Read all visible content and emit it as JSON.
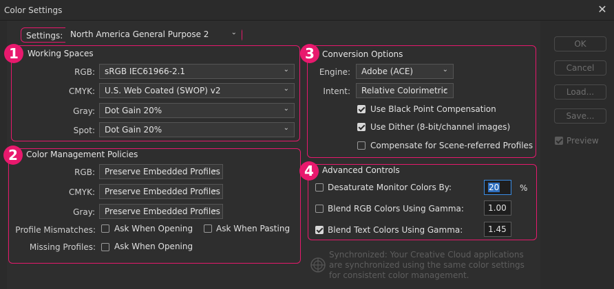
{
  "window": {
    "title": "Color Settings",
    "close_glyph": "✕"
  },
  "settings": {
    "label": "Settings:",
    "value": "North America General Purpose 2"
  },
  "working_spaces": {
    "title": "Working Spaces",
    "badge": "1",
    "rows": [
      {
        "label": "RGB:",
        "value": "sRGB IEC61966-2.1"
      },
      {
        "label": "CMYK:",
        "value": "U.S. Web Coated (SWOP) v2"
      },
      {
        "label": "Gray:",
        "value": "Dot Gain 20%"
      },
      {
        "label": "Spot:",
        "value": "Dot Gain 20%"
      }
    ]
  },
  "policies": {
    "title": "Color Management Policies",
    "badge": "2",
    "rows": [
      {
        "label": "RGB:",
        "value": "Preserve Embedded Profiles"
      },
      {
        "label": "CMYK:",
        "value": "Preserve Embedded Profiles"
      },
      {
        "label": "Gray:",
        "value": "Preserve Embedded Profiles"
      }
    ],
    "mismatch_label": "Profile Mismatches:",
    "mismatch_open": {
      "label": "Ask When Opening",
      "checked": false
    },
    "mismatch_paste": {
      "label": "Ask When Pasting",
      "checked": false
    },
    "missing_label": "Missing Profiles:",
    "missing_open": {
      "label": "Ask When Opening",
      "checked": false
    }
  },
  "conversion": {
    "title": "Conversion Options",
    "badge": "3",
    "engine_label": "Engine:",
    "engine_value": "Adobe (ACE)",
    "intent_label": "Intent:",
    "intent_value": "Relative Colorimetric",
    "black_point": {
      "label": "Use Black Point Compensation",
      "checked": true
    },
    "dither": {
      "label": "Use Dither (8-bit/channel images)",
      "checked": true
    },
    "scene": {
      "label": "Compensate for Scene-referred Profiles",
      "checked": false
    }
  },
  "advanced": {
    "title": "Advanced Controls",
    "badge": "4",
    "desaturate": {
      "label": "Desaturate Monitor Colors By:",
      "value": "20",
      "unit": "%",
      "checked": false
    },
    "blend_rgb": {
      "label": "Blend RGB Colors Using Gamma:",
      "value": "1.00",
      "checked": false
    },
    "blend_text": {
      "label": "Blend Text Colors Using Gamma:",
      "value": "1.45",
      "checked": true
    }
  },
  "buttons": {
    "ok": "OK",
    "cancel": "Cancel",
    "load": "Load...",
    "save": "Save...",
    "preview": "Preview"
  },
  "sync_message": "Synchronized: Your Creative Cloud applications are synchronized using the same color settings for consistent color management.",
  "colors": {
    "accent": "#e8196d",
    "background": "#2b2b2b",
    "focus": "#3a8ee6"
  }
}
